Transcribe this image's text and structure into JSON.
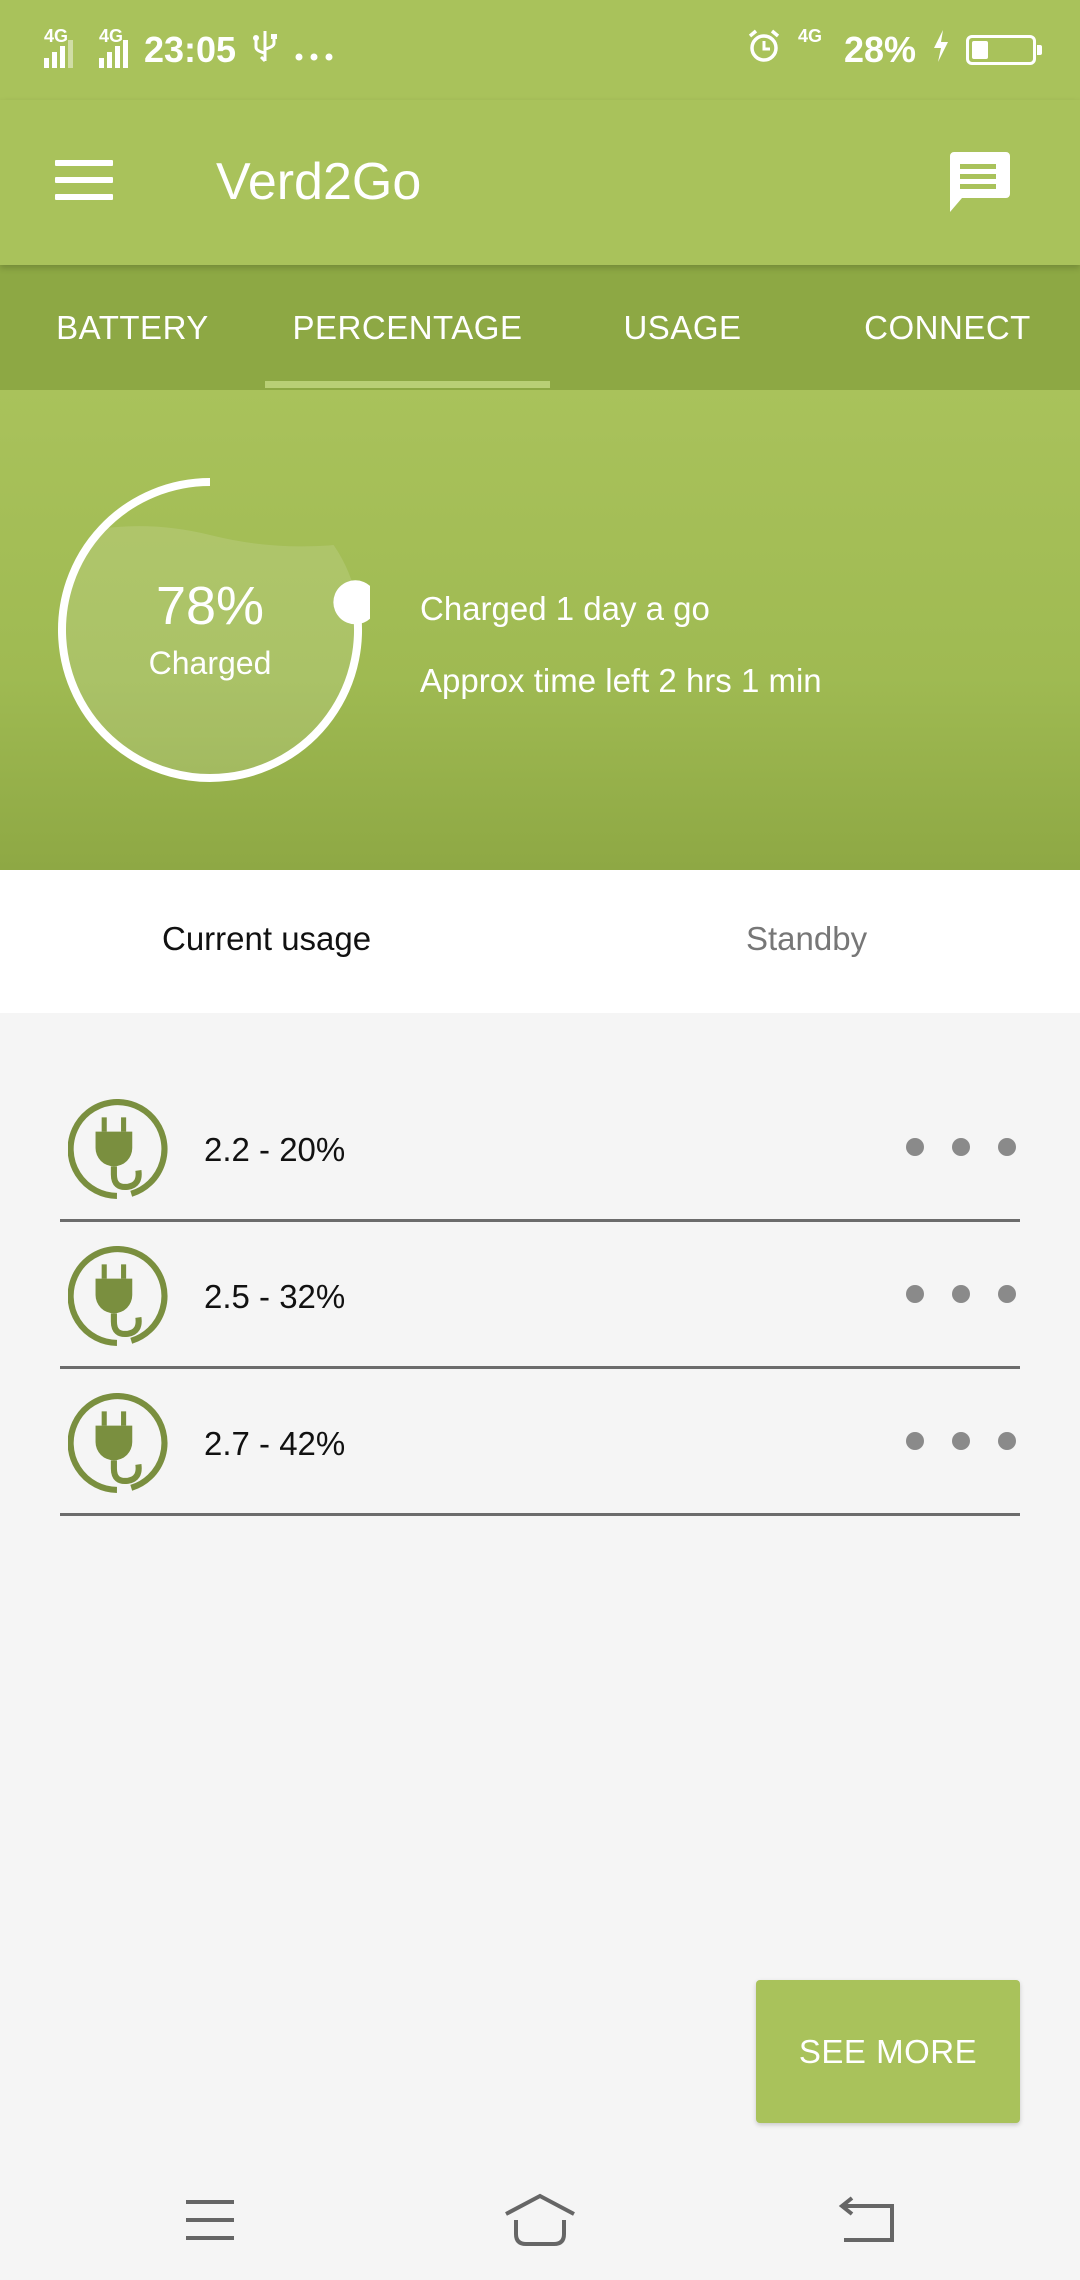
{
  "status_bar": {
    "time": "23:05",
    "network1": "4G",
    "network2": "4G",
    "network3": "4G",
    "battery_text": "28%",
    "battery_level": 0.28,
    "icons": [
      "signal-icon",
      "usb-icon",
      "more-dots-icon",
      "alarm-icon",
      "charging-icon",
      "battery-icon"
    ]
  },
  "app_bar": {
    "title": "Verd2Go",
    "icons": [
      "hamburger-menu-icon",
      "message-icon"
    ]
  },
  "tabs": [
    {
      "label": "BATTERY"
    },
    {
      "label": "PERCENTAGE",
      "selected": true
    },
    {
      "label": "USAGE"
    },
    {
      "label": "CONNECT"
    }
  ],
  "charge": {
    "value_text": "78%",
    "value": 0.78,
    "label": "Charged",
    "last_charged": "Charged 1 day a go",
    "time_left": "Approx time left 2 hrs 1 min"
  },
  "subtabs": {
    "current": "Current usage",
    "standby": "Standby"
  },
  "usage_items": [
    {
      "label": "2.2 - 20%",
      "icon": "plug-icon"
    },
    {
      "label": "2.5 - 32%",
      "icon": "plug-icon"
    },
    {
      "label": "2.7 - 42%",
      "icon": "plug-icon"
    }
  ],
  "see_more_label": "SEE MORE",
  "colors": {
    "primary": "#a9c25b",
    "tab_bar": "#8da844",
    "icon_green": "#7a8f3f"
  }
}
